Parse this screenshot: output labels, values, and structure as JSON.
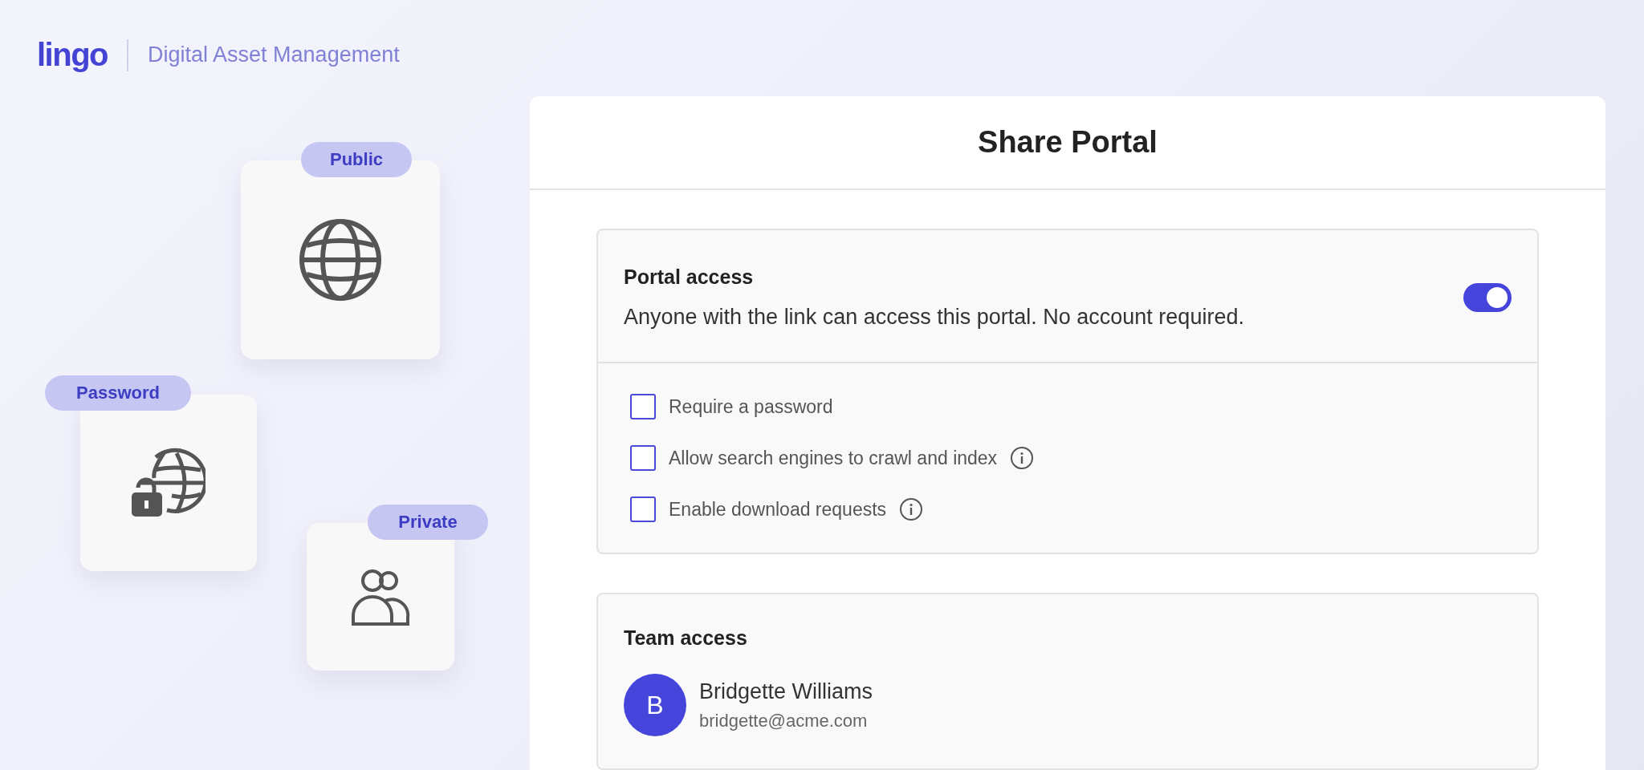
{
  "header": {
    "logo": "lingo",
    "subtitle": "Digital Asset Management"
  },
  "access_types": [
    {
      "label": "Public",
      "kind": "globe"
    },
    {
      "label": "Password",
      "kind": "lock-globe"
    },
    {
      "label": "Private",
      "kind": "people"
    }
  ],
  "share_portal": {
    "title": "Share Portal",
    "portal_access": {
      "title": "Portal access",
      "description": "Anyone with the link can access this portal. No account required.",
      "on": true,
      "options": [
        {
          "label": "Require a password",
          "checked": false,
          "info": false
        },
        {
          "label": "Allow search engines to crawl and index",
          "checked": false,
          "info": true
        },
        {
          "label": "Enable download requests",
          "checked": false,
          "info": true
        }
      ]
    },
    "team_access": {
      "title": "Team access",
      "members": [
        {
          "initial": "B",
          "name": "Bridgette Williams",
          "email": "bridgette@acme.com"
        }
      ]
    }
  }
}
